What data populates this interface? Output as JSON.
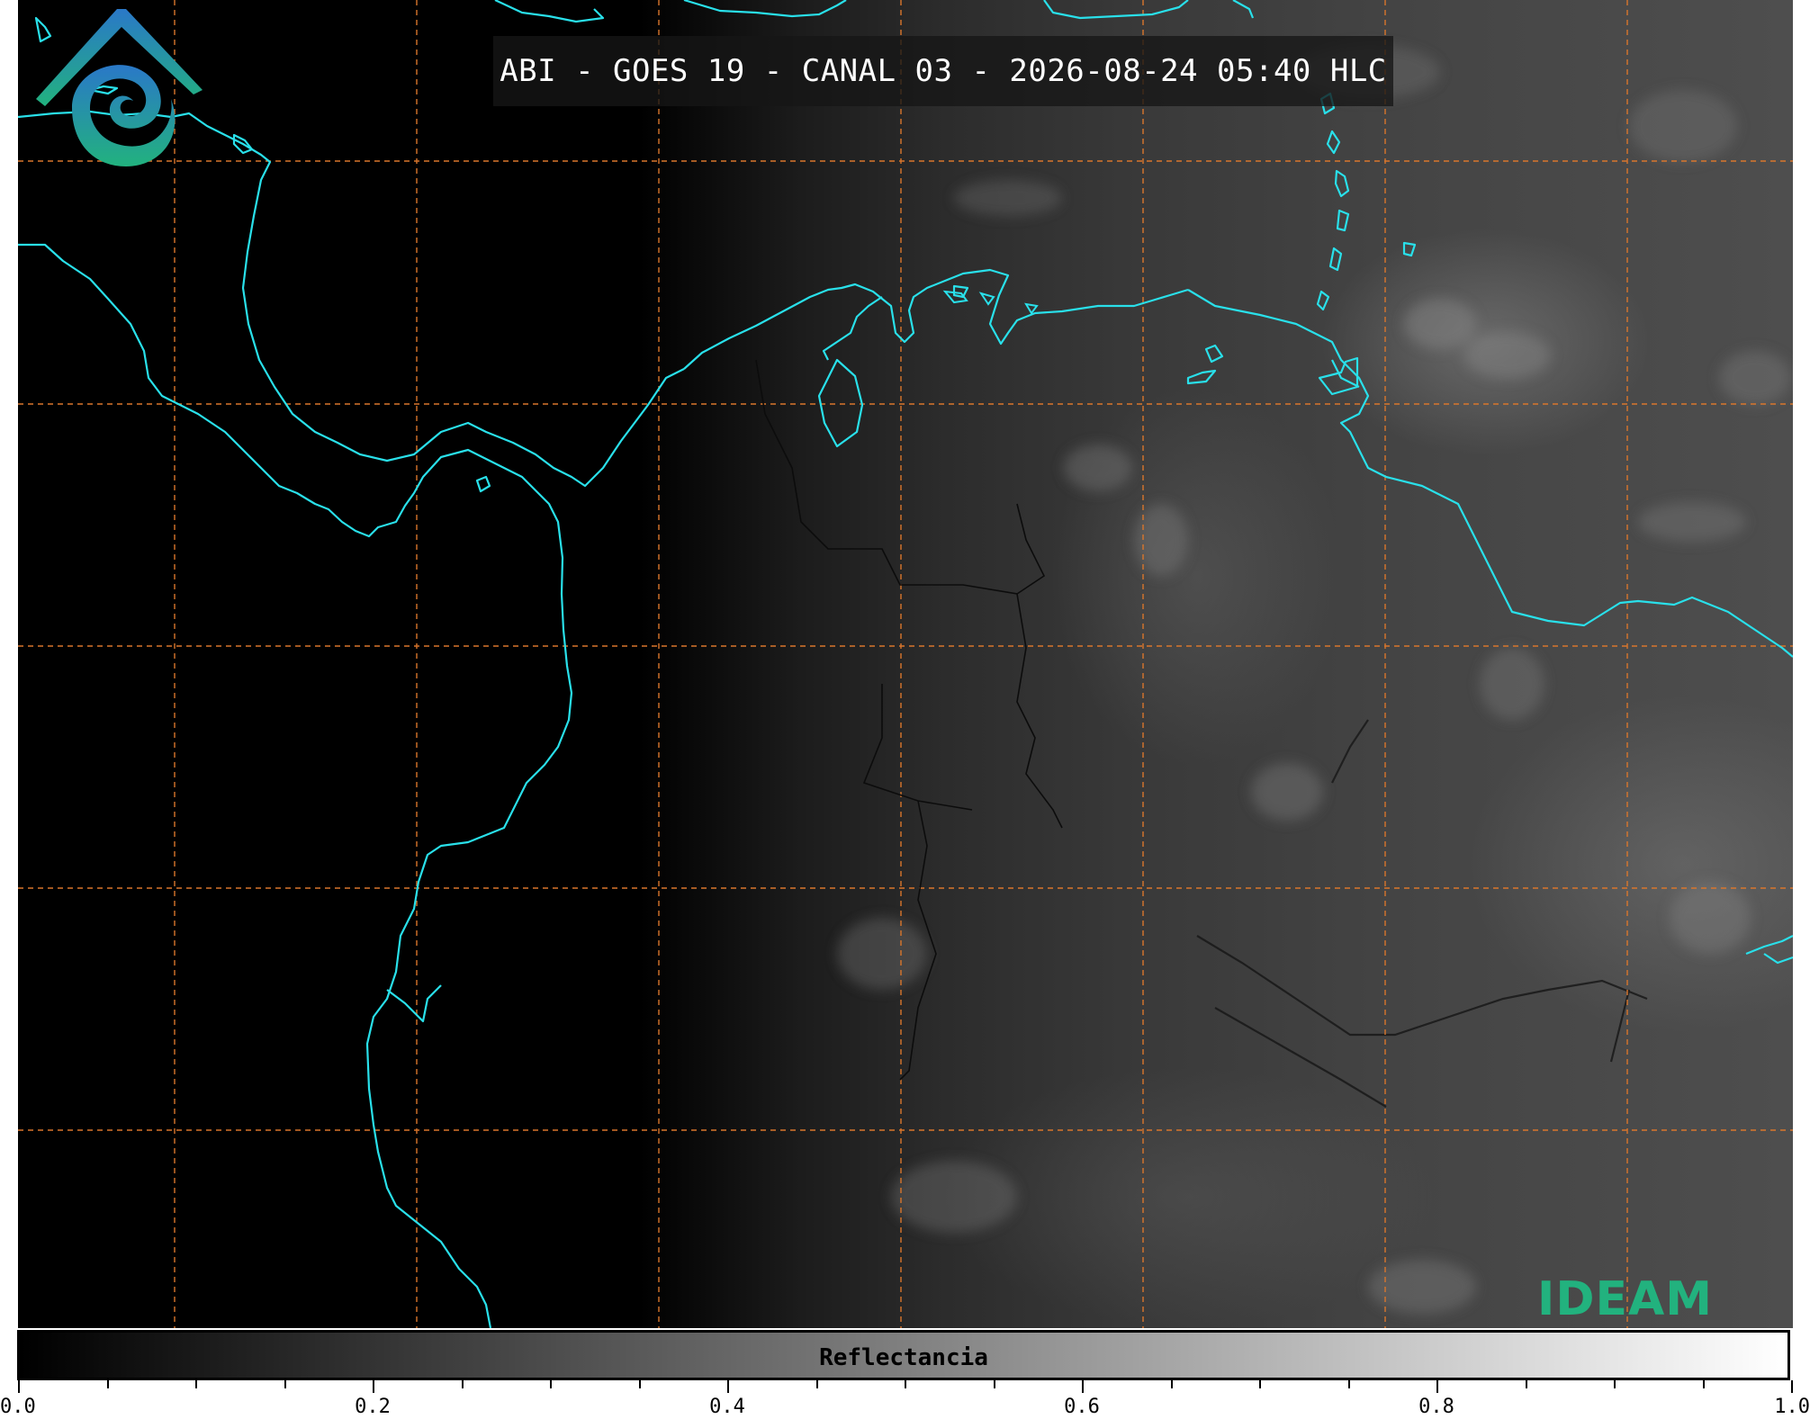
{
  "title": "ABI - GOES 19 - CANAL 03 - 2026-08-24 05:40 HLC",
  "colors": {
    "coastline": "#29e0ea",
    "gridline": "#d9762c",
    "border": "#111111",
    "logo_teal": "#22b27e",
    "logo_blue": "#2a78c8"
  },
  "logo": {
    "text": "IDEAM",
    "icon": "ideam-eye-mountain-logo"
  },
  "colorbar": {
    "label": "Reflectancia",
    "range": [
      0.0,
      1.0
    ],
    "colormap": "grayscale black-to-white",
    "major_ticks": [
      "0.0",
      "0.2",
      "0.4",
      "0.6",
      "0.8",
      "1.0"
    ],
    "minor_step": 0.05
  },
  "map": {
    "projection": "lat-lon graticule with dashed grid",
    "grid": "on",
    "region": "Northwest South America, Central America and Caribbean"
  }
}
